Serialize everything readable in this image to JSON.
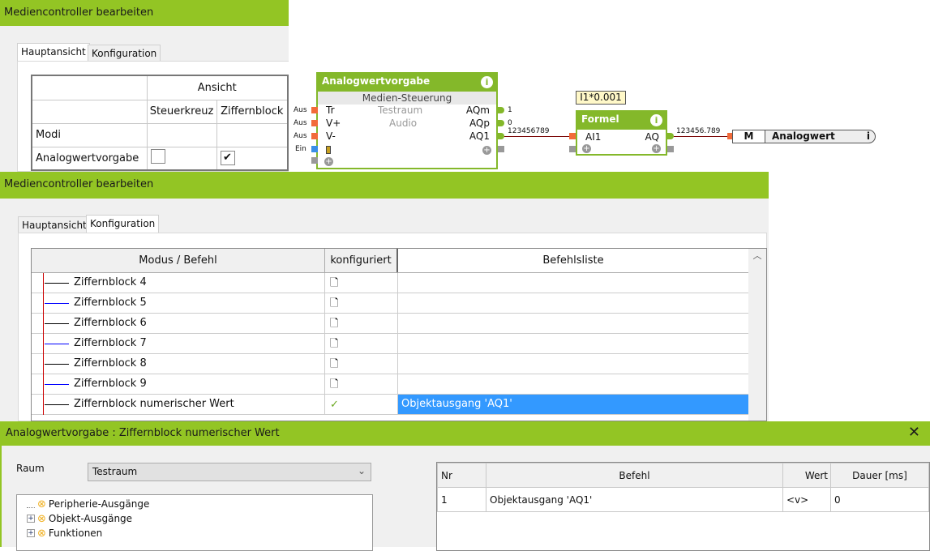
{
  "panel1": {
    "title": "Mediencontroller bearbeiten",
    "tabs": [
      "Hauptansicht",
      "Konfiguration"
    ],
    "table": {
      "group_header": "Ansicht",
      "columns": [
        "Steuerkreuz",
        "Ziffernblock"
      ],
      "rows": [
        {
          "label": "Modi"
        },
        {
          "label": "Analogwertvorgabe",
          "steuerkreuz": false,
          "ziffernblock": true
        }
      ]
    }
  },
  "block1": {
    "title": "Analogwertvorgabe",
    "subtitle": "Medien-Steuerung",
    "room": "Testraum",
    "category": "Audio",
    "inputs": [
      {
        "name": "Tr",
        "tag": "Aus"
      },
      {
        "name": "V+",
        "tag": "Aus"
      },
      {
        "name": "V-",
        "tag": "Aus"
      },
      {
        "name": "",
        "tag": "Ein"
      }
    ],
    "outputs": [
      {
        "name": "AQm",
        "value": "1"
      },
      {
        "name": "AQp",
        "value": "0"
      },
      {
        "name": "AQ1",
        "value": "123456789"
      }
    ]
  },
  "formula_label": "I1*0.001",
  "block2": {
    "title": "Formel",
    "input": "AI1",
    "output": "AQ",
    "value": "123456.789"
  },
  "output_object": {
    "prefix": "M",
    "name": "Analogwert"
  },
  "panel2": {
    "title": "Mediencontroller bearbeiten",
    "tabs": [
      "Hauptansicht",
      "Konfiguration"
    ],
    "columns": [
      "Modus / Befehl",
      "konfiguriert",
      "Befehlsliste"
    ],
    "rows": [
      {
        "name": "Ziffernblock 4",
        "configured": false,
        "commands": ""
      },
      {
        "name": "Ziffernblock 5",
        "configured": false,
        "commands": ""
      },
      {
        "name": "Ziffernblock 6",
        "configured": false,
        "commands": ""
      },
      {
        "name": "Ziffernblock 7",
        "configured": false,
        "commands": ""
      },
      {
        "name": "Ziffernblock 8",
        "configured": false,
        "commands": ""
      },
      {
        "name": "Ziffernblock 9",
        "configured": false,
        "commands": ""
      },
      {
        "name": "Ziffernblock numerischer Wert",
        "configured": true,
        "commands": "Objektausgang 'AQ1'"
      }
    ]
  },
  "dialog": {
    "title": "Analogwertvorgabe : Ziffernblock numerischer Wert",
    "raum_label": "Raum",
    "raum_value": "Testraum",
    "tree": [
      "Peripherie-Ausgänge",
      "Objekt-Ausgänge",
      "Funktionen"
    ],
    "columns": [
      "Nr",
      "Befehl",
      "Wert",
      "Dauer [ms]"
    ],
    "rows": [
      {
        "nr": "1",
        "befehl": "Objektausgang 'AQ1'",
        "wert": "<v>",
        "dauer": "0"
      }
    ]
  },
  "colors": {
    "green": "#93c524",
    "selection": "#3399ff"
  }
}
